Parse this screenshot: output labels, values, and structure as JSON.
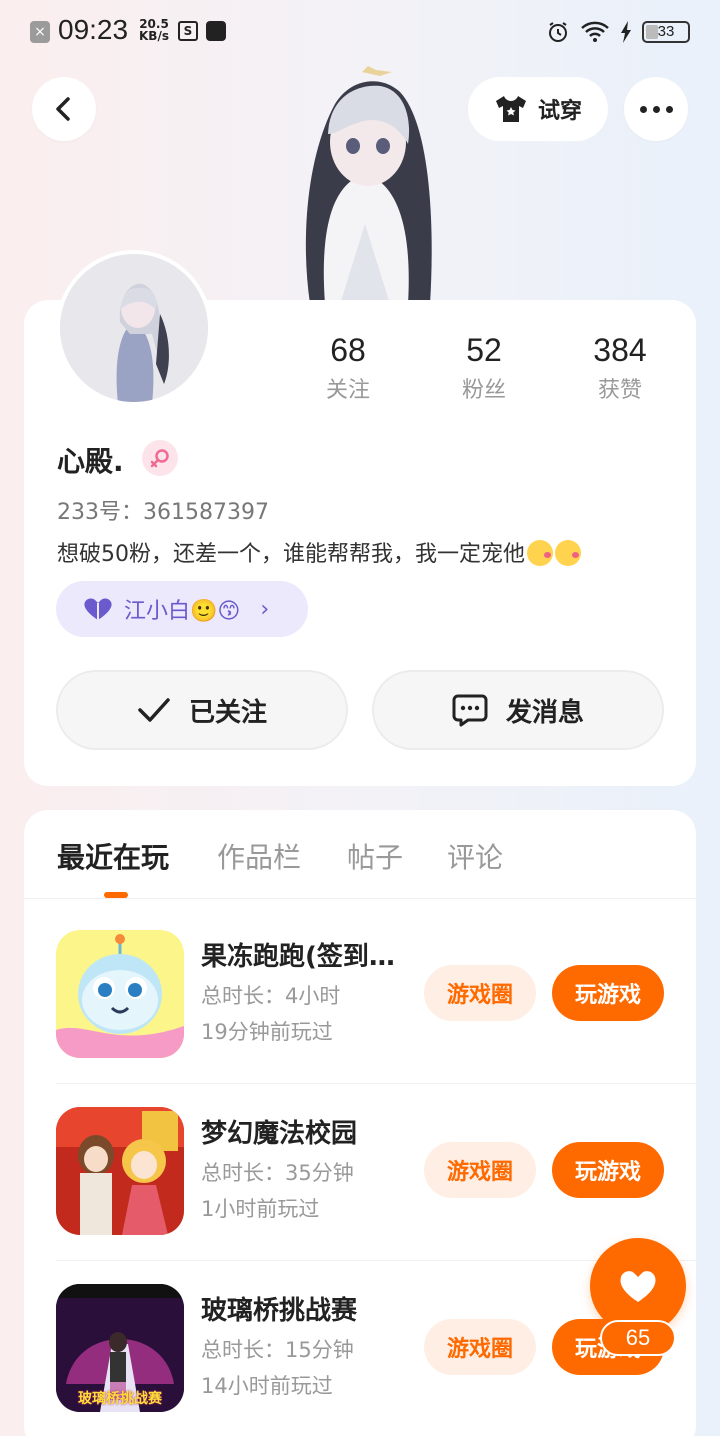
{
  "status_bar": {
    "time": "09:23",
    "net_speed_value": "20.5",
    "net_speed_unit": "KB/s",
    "battery": "33"
  },
  "header": {
    "try_on_label": "试穿"
  },
  "profile": {
    "stats": [
      {
        "value": "68",
        "label": "关注"
      },
      {
        "value": "52",
        "label": "粉丝"
      },
      {
        "value": "384",
        "label": "获赞"
      }
    ],
    "username": "心殿.",
    "id_text": "233号：361587397",
    "bio": "想破50粉，还差一个，谁能帮帮我，我一定宠他",
    "friend_tag": "江小白🙂😙",
    "follow_label": "已关注",
    "message_label": "发消息"
  },
  "tabs": [
    "最近在玩",
    "作品栏",
    "帖子",
    "评论"
  ],
  "games": [
    {
      "name": "果冻跑跑(签到…",
      "duration": "总时长：4小时",
      "last_played": "19分钟前玩过",
      "circle_label": "游戏圈",
      "play_label": "玩游戏"
    },
    {
      "name": "梦幻魔法校园",
      "duration": "总时长：35分钟",
      "last_played": "1小时前玩过",
      "circle_label": "游戏圈",
      "play_label": "玩游戏"
    },
    {
      "name": "玻璃桥挑战赛",
      "duration": "总时长：15分钟",
      "last_played": "14小时前玩过",
      "circle_label": "游戏圈",
      "play_label": "玩游戏",
      "icon_text": "玻璃桥挑战赛"
    }
  ],
  "like": {
    "count": "65"
  },
  "colors": {
    "accent": "#ff6a00",
    "accent_light": "#ffeee4",
    "tag_bg": "#ebe9fb",
    "tag_text": "#6a5acd"
  },
  "icons": [
    "back-arrow-icon",
    "tshirt-icon",
    "more-icon",
    "female-icon",
    "heart-icon",
    "check-icon",
    "chat-icon",
    "chevron-right-icon",
    "heart-fab-icon"
  ]
}
